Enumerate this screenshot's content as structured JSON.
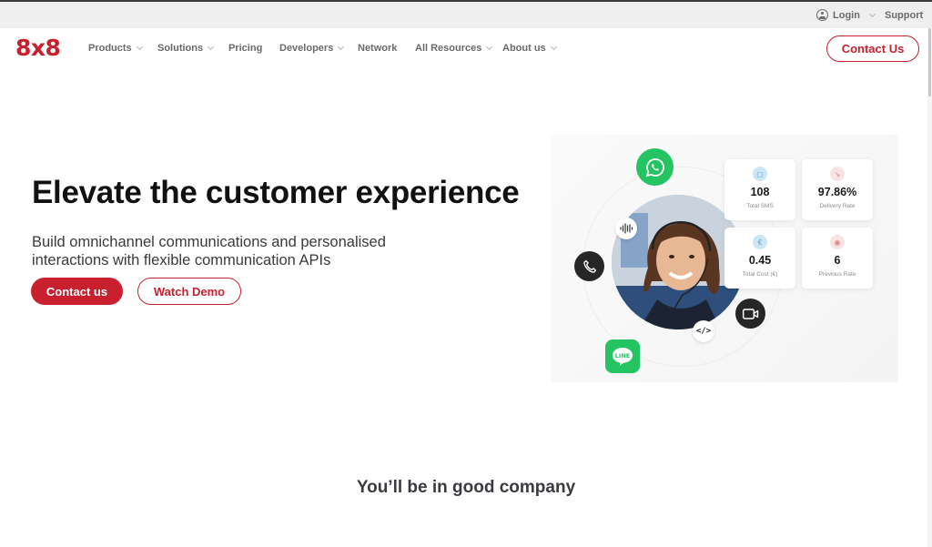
{
  "utility_bar": {
    "login_label": "Login",
    "login_icon": "user-circle-icon",
    "support_label": "Support"
  },
  "nav": {
    "logo": "8x8",
    "items": [
      {
        "label": "Products",
        "has_dropdown": true
      },
      {
        "label": "Solutions",
        "has_dropdown": true
      },
      {
        "label": "Pricing",
        "has_dropdown": false
      },
      {
        "label": "Developers",
        "has_dropdown": true
      },
      {
        "label": "Network",
        "has_dropdown": false
      },
      {
        "label": "All Resources",
        "has_dropdown": true
      },
      {
        "label": "About us",
        "has_dropdown": true
      }
    ],
    "contact_label": "Contact Us"
  },
  "hero": {
    "title": "Elevate the customer experience",
    "subtitle": "Build omnichannel communications and personalised interactions with flexible communication APIs",
    "primary_button": "Contact us",
    "secondary_button": "Watch Demo"
  },
  "visual": {
    "channel_icons": [
      "whatsapp-icon",
      "phone-icon",
      "video-icon",
      "line-icon",
      "voice-wave-icon",
      "code-icon"
    ],
    "code_glyph": "</>",
    "line_label": "LINE",
    "stats": [
      {
        "value": "108",
        "label": "Total SMS",
        "icon": "chat-icon",
        "icon_glyph": "▢"
      },
      {
        "value": "97.86%",
        "label": "Delivery Rate",
        "icon": "trend-down-icon",
        "icon_glyph": "↘"
      },
      {
        "value": "0.45",
        "label": "Total Cost (€)",
        "icon": "euro-icon",
        "icon_glyph": "€"
      },
      {
        "value": "6",
        "label": "Previous Rate",
        "icon": "rate-icon",
        "icon_glyph": "◉"
      }
    ]
  },
  "section": {
    "company_heading": "You’ll be in good company"
  },
  "colors": {
    "brand_red": "#c8202f",
    "whatsapp_green": "#25c462",
    "dark_icon": "#262626"
  }
}
